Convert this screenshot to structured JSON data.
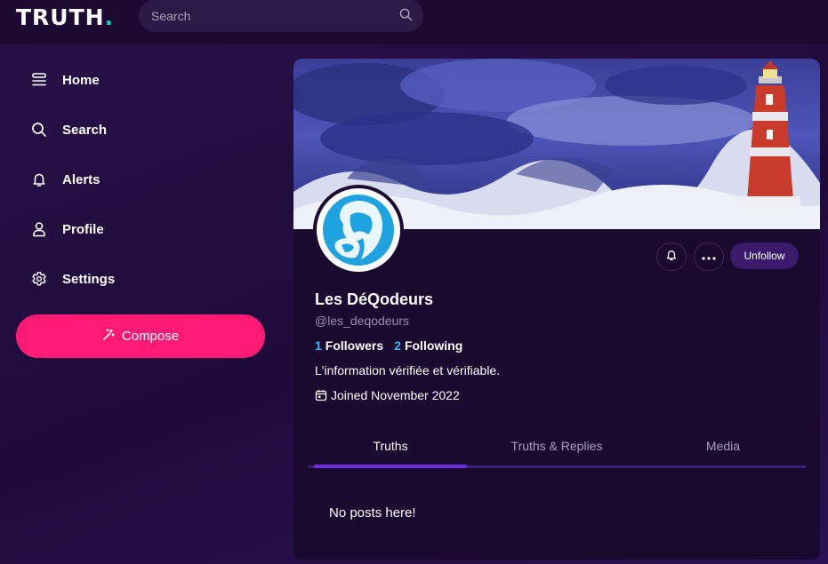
{
  "header": {
    "logo_text": "TRUTH",
    "logo_dot": ".",
    "search_placeholder": "Search"
  },
  "sidebar": {
    "items": [
      {
        "label": "Home",
        "icon": "home-icon"
      },
      {
        "label": "Search",
        "icon": "search-icon"
      },
      {
        "label": "Alerts",
        "icon": "bell-icon"
      },
      {
        "label": "Profile",
        "icon": "user-icon"
      },
      {
        "label": "Settings",
        "icon": "gear-icon"
      }
    ],
    "compose_label": "Compose"
  },
  "profile": {
    "display_name": "Les DéQodeurs",
    "handle": "@les_deqodeurs",
    "followers_count": "1",
    "followers_label": "Followers",
    "following_count": "2",
    "following_label": "Following",
    "bio": "L'information vérifiée et vérifiable.",
    "joined": "Joined November 2022",
    "unfollow_label": "Unfollow"
  },
  "tabs": [
    {
      "label": "Truths",
      "active": true
    },
    {
      "label": "Truths & Replies",
      "active": false
    },
    {
      "label": "Media",
      "active": false
    }
  ],
  "feed": {
    "empty_message": "No posts here!"
  },
  "colors": {
    "accent": "#ff1a75",
    "link": "#2fb6ff",
    "logo_dot": "#17d3c5",
    "tab_active": "#6d2ce0"
  }
}
